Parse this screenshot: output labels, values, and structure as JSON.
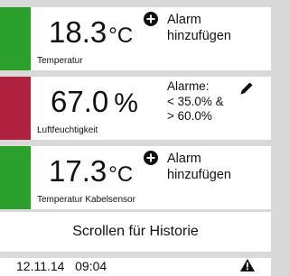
{
  "colors": {
    "ok": "#2ca02c",
    "alarm": "#b0213f",
    "background": "#d9d9d9",
    "card": "#ffffff"
  },
  "sensors": [
    {
      "value": "18.3",
      "unit": "°C",
      "label": "Temperatur",
      "status": "ok",
      "alarm_lines": [
        "Alarm",
        "hinzufügen"
      ],
      "action_icon": "plus-circle-icon"
    },
    {
      "value": "67.0",
      "unit": "%",
      "label": "Luftfeuchtigkeit",
      "status": "alarm",
      "alarm_lines": [
        "Alarme:",
        "< 35.0% &",
        "> 60.0%"
      ],
      "action_icon": "pencil-icon"
    },
    {
      "value": "17.3",
      "unit": "°C",
      "label": "Temperatur Kabelsensor",
      "status": "ok",
      "alarm_lines": [
        "Alarm",
        "hinzufügen"
      ],
      "action_icon": "plus-circle-icon"
    }
  ],
  "history_button": {
    "label": "Scrollen für Historie"
  },
  "log_entry": {
    "text": "12.11.14   09:04",
    "icon": "warning-triangle-icon"
  }
}
